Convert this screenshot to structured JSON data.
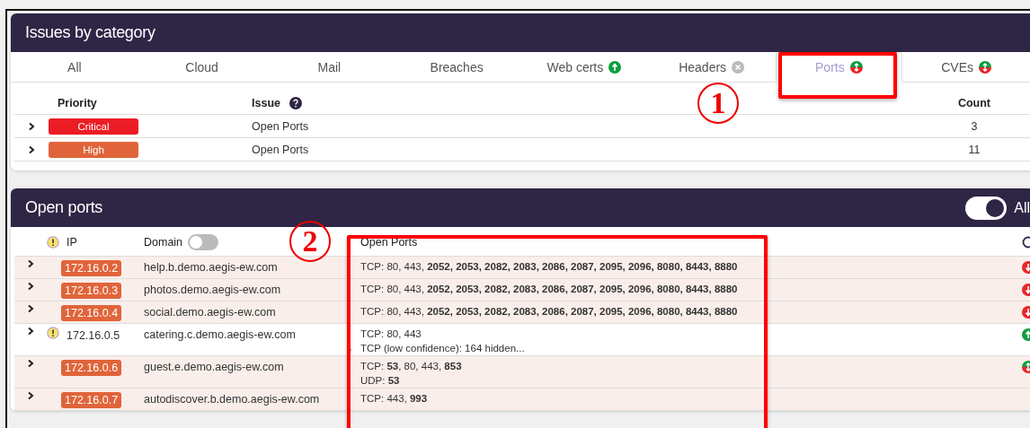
{
  "issues_panel": {
    "title": "Issues by category",
    "tabs": [
      {
        "label": "All",
        "selected": false
      },
      {
        "label": "Cloud",
        "selected": false
      },
      {
        "label": "Mail",
        "selected": false
      },
      {
        "label": "Breaches",
        "selected": false
      },
      {
        "label": "Web certs",
        "selected": false,
        "trend": {
          "kind": "up"
        }
      },
      {
        "label": "Headers",
        "selected": false,
        "trend": {
          "kind": "cleared"
        }
      },
      {
        "label": "Ports",
        "selected": true,
        "trend": {
          "kind": "mixed"
        }
      },
      {
        "label": "CVEs",
        "selected": false,
        "trend": {
          "kind": "mixed"
        }
      }
    ],
    "columns": {
      "priority": "Priority",
      "issue": "Issue",
      "count": "Count"
    },
    "rows": [
      {
        "priority": "Critical",
        "color": "#ec1c24",
        "issue": "Open Ports",
        "count": "3"
      },
      {
        "priority": "High",
        "color": "#e0643a",
        "issue": "Open Ports",
        "count": "11"
      }
    ]
  },
  "ports_panel": {
    "title": "Open ports",
    "toggle": {
      "label": "All",
      "on": true
    },
    "columns": {
      "ip": "IP",
      "domain": "Domain",
      "ports": "Open Ports"
    },
    "domain_toggle_on": false,
    "rows": [
      {
        "ip": "172.16.0.2",
        "kind": "high",
        "domain": "help.b.demo.aegis-ew.com",
        "trend": {
          "kind": "down"
        },
        "ports": [
          {
            "text": "TCP: 80, 443, **2052, 2053, 2082, 2083, 2086, 2087, 2095, 2096, 8080, 8443, 8880**"
          }
        ]
      },
      {
        "ip": "172.16.0.3",
        "kind": "high",
        "domain": "photos.demo.aegis-ew.com",
        "trend": {
          "kind": "down"
        },
        "ports": [
          {
            "text": "TCP: 80, 443, **2052, 2053, 2082, 2083, 2086, 2087, 2095, 2096, 8080, 8443, 8880**"
          }
        ]
      },
      {
        "ip": "172.16.0.4",
        "kind": "high",
        "domain": "social.demo.aegis-ew.com",
        "trend": {
          "kind": "down"
        },
        "ports": [
          {
            "text": "TCP: 80, 443, **2052, 2053, 2082, 2083, 2086, 2087, 2095, 2096, 8080, 8443, 8880**"
          }
        ]
      },
      {
        "ip": "172.16.0.5",
        "kind": "warning",
        "domain": "catering.c.demo.aegis-ew.com",
        "trend": {
          "kind": "up"
        },
        "ports": [
          {
            "text": "TCP: 80, 443"
          },
          {
            "text": "TCP (low confidence):  164 hidden...",
            "collapsible": true
          }
        ]
      },
      {
        "ip": "172.16.0.6",
        "kind": "high",
        "domain": "guest.e.demo.aegis-ew.com",
        "trend": {
          "kind": "mixed"
        },
        "ports": [
          {
            "text": "TCP: **53**, 80, 443, **853**"
          },
          {
            "text": "UDP: **53**"
          }
        ]
      },
      {
        "ip": "172.16.0.7",
        "kind": "high",
        "domain": "autodiscover.b.demo.aegis-ew.com",
        "ports": [
          {
            "text": "TCP: 443, **993**"
          }
        ]
      }
    ]
  },
  "annotations": [
    {
      "label": "1"
    },
    {
      "label": "2"
    }
  ]
}
